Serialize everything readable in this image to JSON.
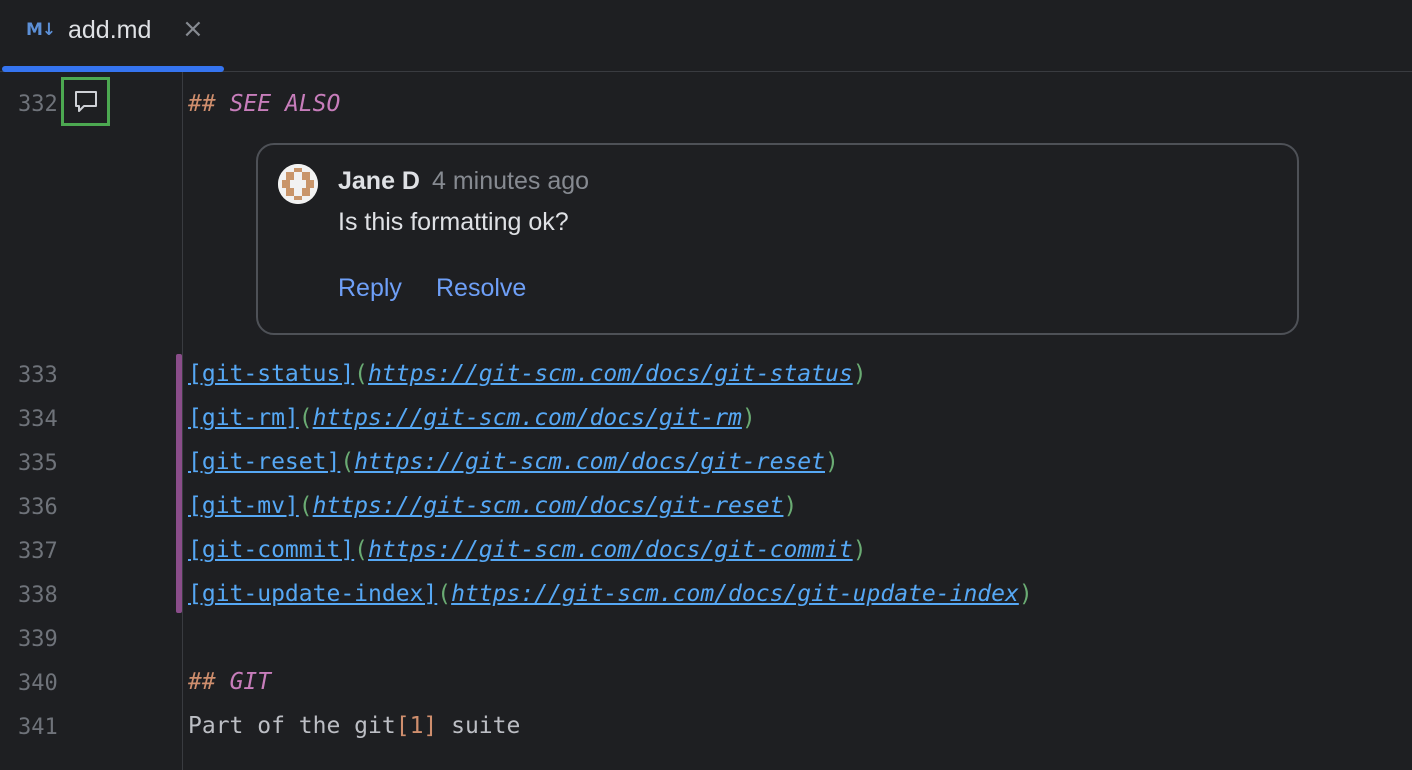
{
  "tab": {
    "icon": "markdown-icon",
    "icon_text": "M↓",
    "title": "add.md",
    "close": "×"
  },
  "gutter": {
    "line_numbers": [
      "332",
      "333",
      "334",
      "335",
      "336",
      "337",
      "338",
      "339",
      "340",
      "341"
    ]
  },
  "editor": {
    "see_also_hash": "##",
    "see_also_text": "SEE ALSO",
    "links": [
      {
        "text": "[git-status]",
        "url": "https://git-scm.com/docs/git-status"
      },
      {
        "text": "[git-rm]",
        "url": "https://git-scm.com/docs/git-rm"
      },
      {
        "text": "[git-reset]",
        "url": "https://git-scm.com/docs/git-reset"
      },
      {
        "text": "[git-mv]",
        "url": "https://git-scm.com/docs/git-reset"
      },
      {
        "text": "[git-commit]",
        "url": "https://git-scm.com/docs/git-commit"
      },
      {
        "text": "[git-update-index]",
        "url": "https://git-scm.com/docs/git-update-index"
      }
    ],
    "git_hash": "##",
    "git_text": "GIT",
    "last_line_pre": "Part of the git",
    "last_line_ref": "[1]",
    "last_line_post": " suite"
  },
  "comment": {
    "author": "Jane D",
    "time": "4 minutes ago",
    "message": "Is this formatting ok?",
    "reply": "Reply",
    "resolve": "Resolve"
  },
  "colors": {
    "background": "#1e1f22",
    "accent": "#3574f0",
    "heading": "#c77dbb",
    "link": "#56a8f5",
    "paren": "#6aab73",
    "marker": "#4ca851"
  }
}
